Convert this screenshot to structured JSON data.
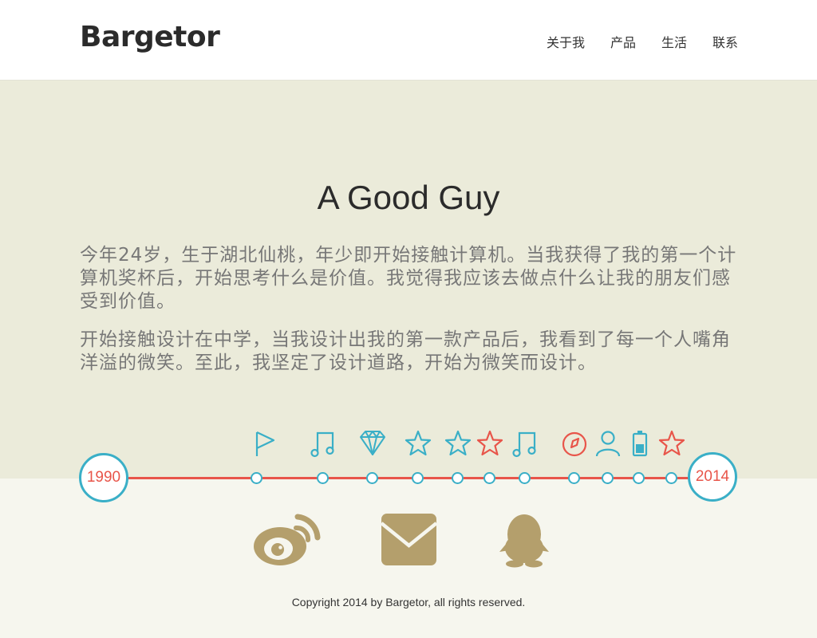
{
  "header": {
    "logo": "Bargetor",
    "nav": [
      "关于我",
      "产品",
      "生活",
      "联系"
    ]
  },
  "hero": {
    "title": "A Good Guy",
    "paragraphs": [
      "今年24岁，生于湖北仙桃，年少即开始接触计算机。当我获得了我的第一个计算机奖杯后，开始思考什么是价值。我觉得我应该去做点什么让我的朋友们感受到价值。",
      "开始接触设计在中学，当我设计出我的第一款产品后，我看到了每一个人嘴角洋溢的微笑。至此，我坚定了设计道路，开始为微笑而设计。"
    ]
  },
  "timeline": {
    "start_year": "1990",
    "end_year": "2014",
    "icons": [
      "flag-icon",
      "music-note-icon",
      "diamond-icon",
      "star-icon",
      "star-icon",
      "star-red-icon",
      "music-note-icon",
      "compass-icon",
      "user-icon",
      "battery-icon",
      "star-red-icon"
    ]
  },
  "social": [
    "weibo-icon",
    "mail-icon",
    "qq-icon"
  ],
  "footer": {
    "copyright": "Copyright 2014 by Bargetor, all rights reserved."
  },
  "colors": {
    "accent_blue": "#3aafc7",
    "accent_red": "#e8554a",
    "social_gold": "#b49f6c",
    "hero_bg": "#ebebda",
    "page_bg": "#f6f6ee"
  }
}
